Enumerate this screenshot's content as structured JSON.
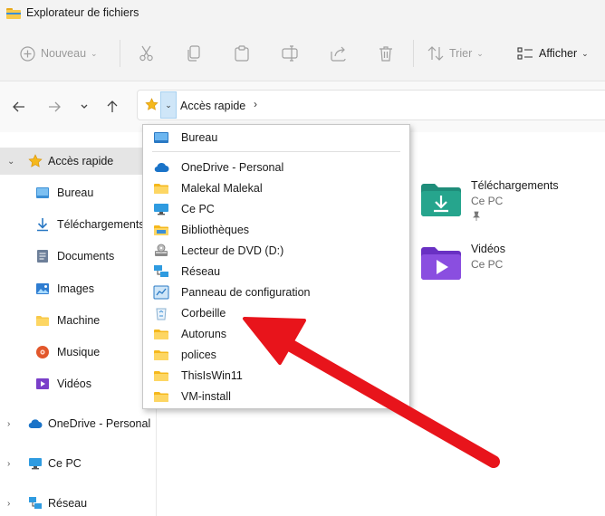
{
  "window": {
    "title": "Explorateur de fichiers"
  },
  "toolbar": {
    "new_label": "Nouveau",
    "sort_label": "Trier",
    "view_label": "Afficher",
    "more_label": "···"
  },
  "address": {
    "location": "Accès rapide"
  },
  "sidebar": {
    "items": [
      {
        "label": "Accès rapide",
        "icon": "star-icon"
      },
      {
        "label": "Bureau",
        "icon": "desktop-icon"
      },
      {
        "label": "Téléchargements",
        "icon": "download-icon"
      },
      {
        "label": "Documents",
        "icon": "documents-icon"
      },
      {
        "label": "Images",
        "icon": "images-icon"
      },
      {
        "label": "Machine",
        "icon": "folder-icon"
      },
      {
        "label": "Musique",
        "icon": "music-icon"
      },
      {
        "label": "Vidéos",
        "icon": "videos-icon"
      },
      {
        "label": "OneDrive - Personal",
        "icon": "cloud-icon"
      },
      {
        "label": "Ce PC",
        "icon": "computer-icon"
      },
      {
        "label": "Réseau",
        "icon": "network-icon"
      }
    ]
  },
  "content": {
    "items": [
      {
        "name": "Téléchargements",
        "location": "Ce PC",
        "icon": "downloads-folder-icon"
      },
      {
        "name": "Vidéos",
        "location": "Ce PC",
        "icon": "videos-folder-icon"
      }
    ]
  },
  "dropdown": {
    "items": [
      {
        "label": "Bureau",
        "icon": "desktop-icon"
      },
      {
        "label": "OneDrive - Personal",
        "icon": "cloud-icon"
      },
      {
        "label": "Malekal Malekal",
        "icon": "folder-icon"
      },
      {
        "label": "Ce PC",
        "icon": "computer-icon"
      },
      {
        "label": "Bibliothèques",
        "icon": "library-icon"
      },
      {
        "label": "Lecteur de DVD (D:)",
        "icon": "dvd-icon"
      },
      {
        "label": "Réseau",
        "icon": "network-icon"
      },
      {
        "label": "Panneau de configuration",
        "icon": "control-panel-icon"
      },
      {
        "label": "Corbeille",
        "icon": "recycle-bin-icon"
      },
      {
        "label": "Autoruns",
        "icon": "folder-icon"
      },
      {
        "label": "polices",
        "icon": "folder-icon"
      },
      {
        "label": "ThisIsWin11",
        "icon": "folder-icon"
      },
      {
        "label": "VM-install",
        "icon": "folder-icon"
      }
    ]
  },
  "colors": {
    "accent": "#0067c0",
    "folder": "#f8c94a",
    "annotation_arrow": "#e8141b",
    "dropdown_highlight": "#cfe6f8"
  }
}
